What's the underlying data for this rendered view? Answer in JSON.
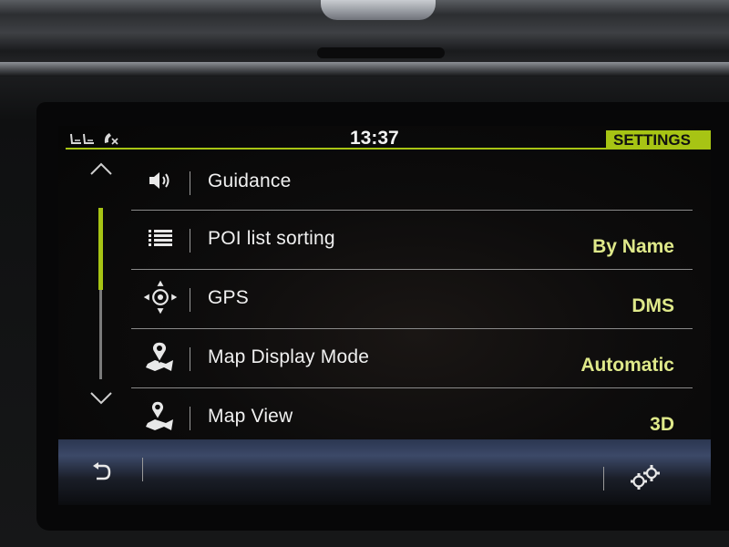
{
  "status": {
    "time": "13:37",
    "section": "SETTINGS"
  },
  "colors": {
    "accent": "#a7c414",
    "value_text": "#dfe98a"
  },
  "scroll": {
    "up_icon": "chevron-up-icon",
    "down_icon": "chevron-down-icon"
  },
  "settings": [
    {
      "icon": "speaker-icon",
      "label": "Guidance",
      "value": ""
    },
    {
      "icon": "list-icon",
      "label": "POI list sorting",
      "value": "By Name"
    },
    {
      "icon": "gps-crosshair-icon",
      "label": "GPS",
      "value": "DMS"
    },
    {
      "icon": "map-pin-icon",
      "label": "Map Display Mode",
      "value": "Automatic"
    },
    {
      "icon": "map-view-icon",
      "label": "Map View",
      "value": "3D"
    }
  ],
  "bottom": {
    "back_icon": "back-arrow-icon",
    "settings_icon": "gears-icon"
  }
}
